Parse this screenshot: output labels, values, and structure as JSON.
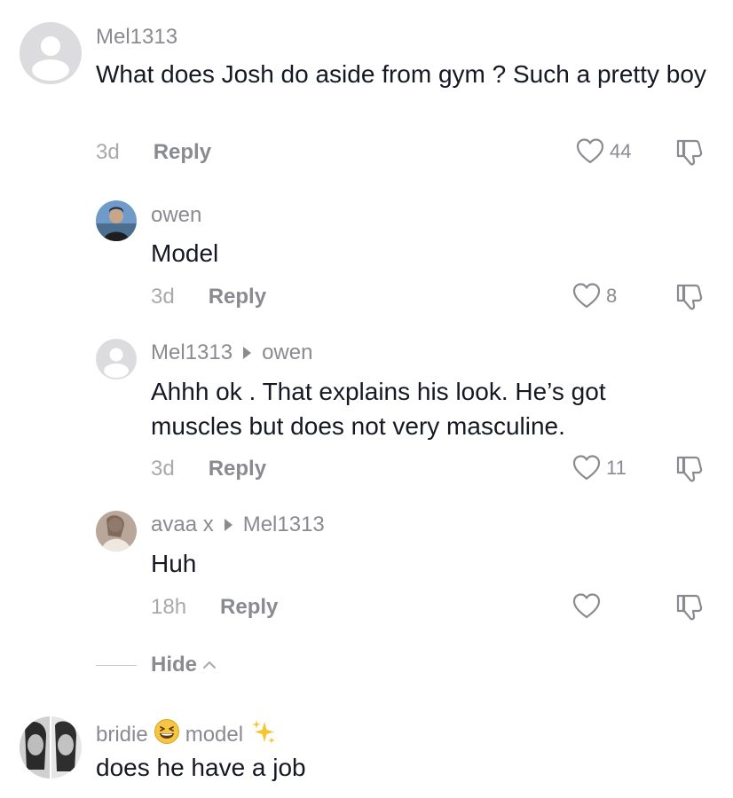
{
  "comments": [
    {
      "username": "Mel1313",
      "text": "What does Josh do aside from gym ? Such a pretty boy",
      "time": "3d",
      "reply_label": "Reply",
      "likes": "44"
    }
  ],
  "replies": [
    {
      "username": "owen",
      "reply_to": "",
      "text": "Model",
      "time": "3d",
      "reply_label": "Reply",
      "likes": "8"
    },
    {
      "username": "Mel1313",
      "reply_to": "owen",
      "text": "Ahhh ok . That explains his look. He’s got muscles but does not very masculine.",
      "time": "3d",
      "reply_label": "Reply",
      "likes": "11"
    },
    {
      "username": "avaa x",
      "reply_to": "Mel1313",
      "text": "Huh",
      "time": "18h",
      "reply_label": "Reply",
      "likes": ""
    }
  ],
  "hide_label": "Hide",
  "last_comment": {
    "username_part1": "bridie",
    "username_part2": "model",
    "text": "does he have a job"
  },
  "icons": {
    "like": "heart-outline-icon",
    "dislike": "thumbs-down-icon",
    "hide": "chevron-up-icon",
    "default_avatar": "default-user-avatar"
  },
  "colors": {
    "text_primary": "#161823",
    "text_secondary": "#8a8b91",
    "avatar_gray": "#d9d9dc"
  }
}
